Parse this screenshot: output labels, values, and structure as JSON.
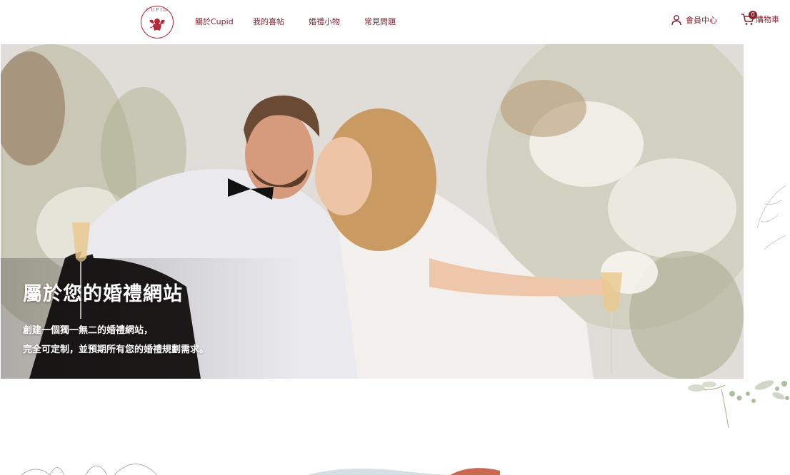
{
  "header": {
    "logo_text": "CUPID",
    "nav": [
      {
        "label": "關於Cupid"
      },
      {
        "label": "我的喜帖"
      },
      {
        "label": "婚禮小物"
      },
      {
        "label": "常見問題"
      }
    ],
    "member_label": "會員中心",
    "cart_label": "購物車",
    "cart_count": "0"
  },
  "hero": {
    "title": "屬於您的婚禮網站",
    "subtitle_line1": "創建一個獨一無二的婚禮網站，",
    "subtitle_line2": "完全可定制，並預期所有您的婚禮規劃需求。"
  },
  "colors": {
    "brand": "#8a2230",
    "logo_red": "#b52b3a"
  },
  "icons": [
    "cupid-logo-icon",
    "user-icon",
    "cart-icon"
  ]
}
